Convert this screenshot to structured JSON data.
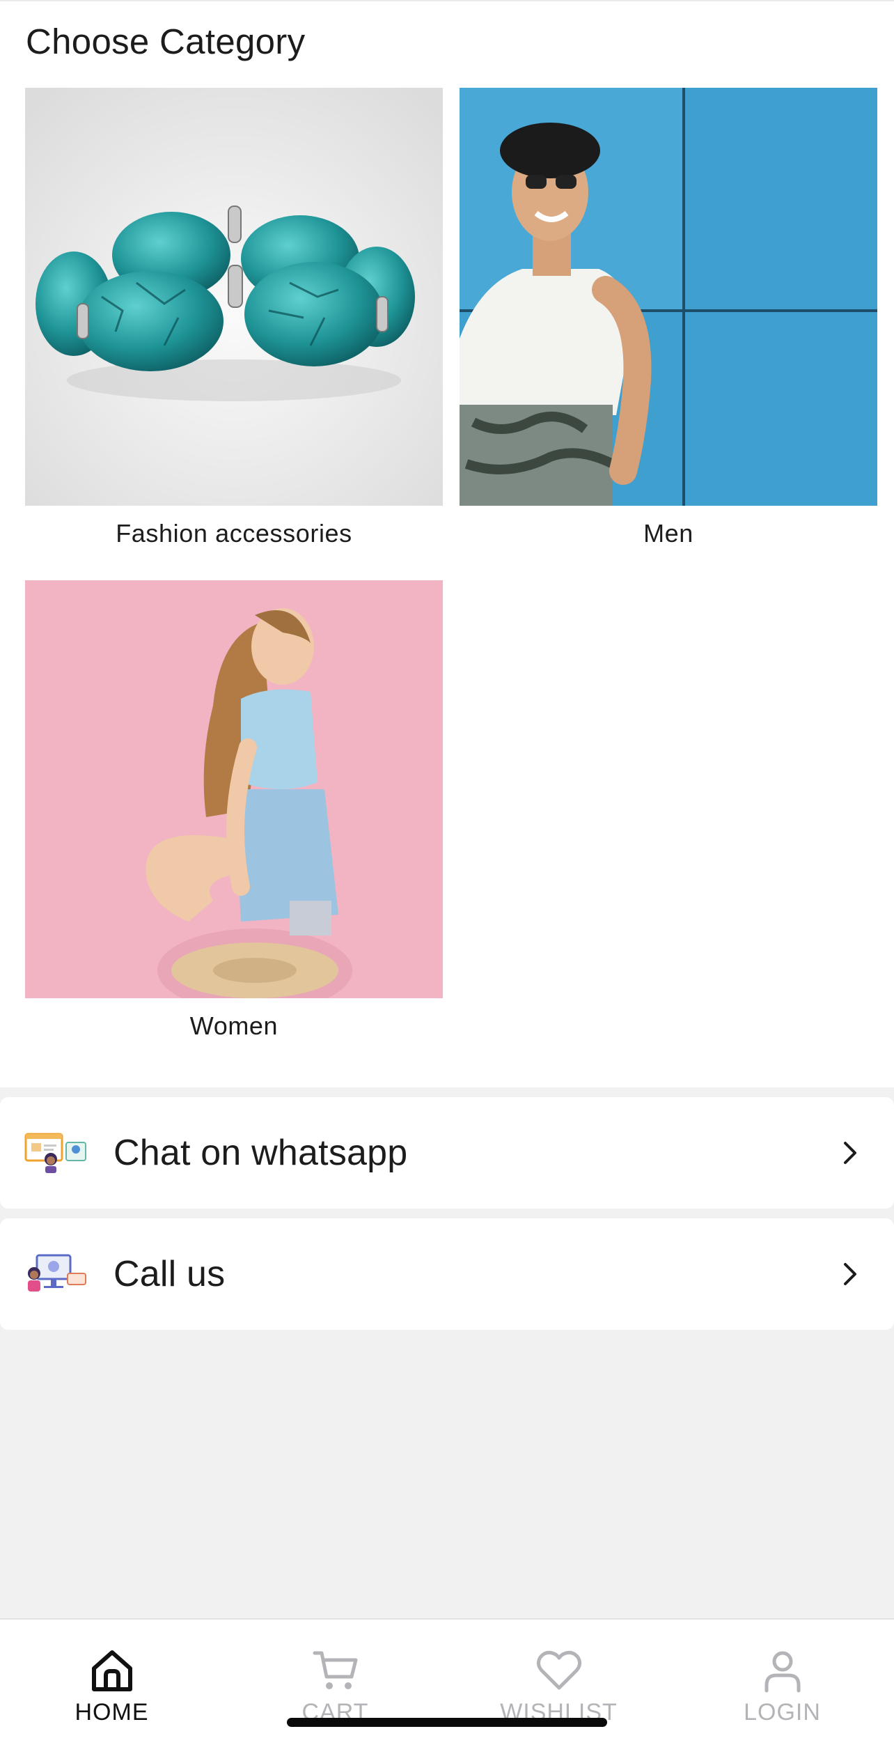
{
  "header": {
    "title": "Choose Category"
  },
  "categories": [
    {
      "label": "Fashion accessories",
      "image_icon": "bracelet-image"
    },
    {
      "label": "Men",
      "image_icon": "man-image"
    },
    {
      "label": "Women",
      "image_icon": "woman-image"
    }
  ],
  "contact": {
    "whatsapp_label": "Chat on whatsapp",
    "call_label": "Call us"
  },
  "bottom_nav": [
    {
      "label": "HOME",
      "icon": "home-icon",
      "active": true
    },
    {
      "label": "CART",
      "icon": "cart-icon",
      "active": false
    },
    {
      "label": "WISHLIST",
      "icon": "heart-icon",
      "active": false
    },
    {
      "label": "LOGIN",
      "icon": "user-icon",
      "active": false
    }
  ],
  "colors": {
    "background": "#f1f1f1",
    "surface": "#ffffff",
    "text": "#1c1c1e",
    "nav_inactive": "#b4b4b8",
    "men_background": "#3d9ccc",
    "women_background": "#f3b3c2",
    "bracelet": "#2aa3a6"
  }
}
